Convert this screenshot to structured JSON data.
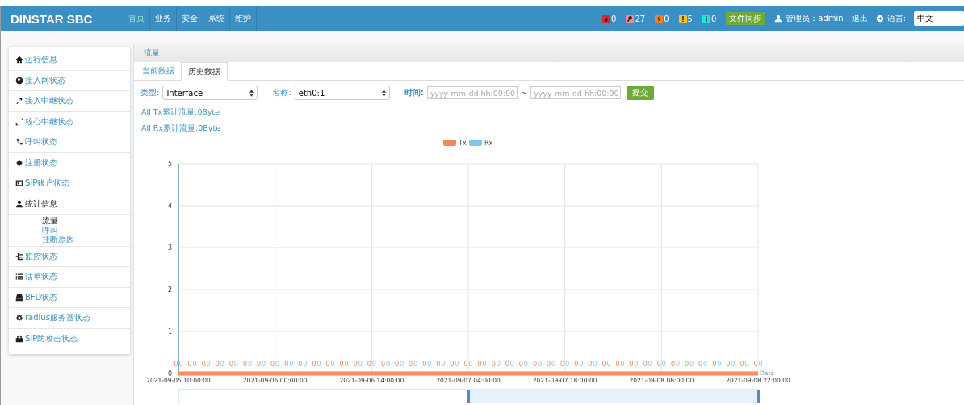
{
  "header": {
    "logo": "DINSTAR SBC",
    "nav": [
      {
        "label": "首页",
        "selected": true
      },
      {
        "label": "业务",
        "selected": false
      },
      {
        "label": "安全",
        "selected": false
      },
      {
        "label": "系统",
        "selected": false
      },
      {
        "label": "维护",
        "selected": false
      }
    ],
    "alerts": [
      {
        "kind": "fire",
        "color": "#e0262b",
        "count": "0"
      },
      {
        "kind": "key",
        "color": "#f08c8c",
        "count": "27"
      },
      {
        "kind": "bolt",
        "color": "#f0862a",
        "count": "0"
      },
      {
        "kind": "exclaim",
        "color": "#f2c037",
        "count": "5"
      },
      {
        "kind": "info",
        "color": "#19e6e6",
        "count": "0"
      }
    ],
    "sync_button": "文件同步",
    "user": "管理员：admin",
    "logout": "退出",
    "language_label": "语言:",
    "language": "中文"
  },
  "sidebar": {
    "items": [
      {
        "kind": "home",
        "label": "运行信息",
        "expanded": false
      },
      {
        "kind": "globe",
        "label": "接入网状态",
        "expanded": false
      },
      {
        "kind": "arrow",
        "label": "接入中继状态",
        "expanded": false
      },
      {
        "kind": "arrows",
        "label": "核心中继状态",
        "expanded": false
      },
      {
        "kind": "phone",
        "label": "呼叫状态",
        "expanded": false
      },
      {
        "kind": "gear",
        "label": "注册状态",
        "expanded": false
      },
      {
        "kind": "card",
        "label": "SIP账户状态",
        "expanded": false
      },
      {
        "kind": "user",
        "label": "统计信息",
        "expanded": true,
        "children": [
          {
            "label": "流量",
            "selected": true
          },
          {
            "label": "呼叫",
            "selected": false
          },
          {
            "label": "挂断原因",
            "selected": false
          }
        ]
      },
      {
        "kind": "tree",
        "label": "监控状态",
        "expanded": false
      },
      {
        "kind": "list",
        "label": "话单状态",
        "expanded": false
      },
      {
        "kind": "drive",
        "label": "BFD状态",
        "expanded": false
      },
      {
        "kind": "cog",
        "label": "radius服务器状态",
        "expanded": false
      },
      {
        "kind": "lock",
        "label": "SIP防攻击状态",
        "expanded": false
      }
    ]
  },
  "panel": {
    "title": "流量",
    "tabs": [
      {
        "label": "当前数据",
        "selected": false
      },
      {
        "label": "历史数据",
        "selected": true
      }
    ],
    "filters": {
      "type_label": "类型:",
      "type": "Interface",
      "name_label": "名称:",
      "name": "eth0:1",
      "time_label": "时间:",
      "start_placeholder": "yyyy-mm-dd hh:00:00",
      "separator": "~",
      "end_placeholder": "yyyy-mm-dd hh:00:00",
      "submit": "提交"
    },
    "totals": [
      "All Tx累计流量:0Byte",
      "All Rx累计流量:0Byte"
    ],
    "chart_data": {
      "type": "line",
      "xlabel": "Data",
      "grid": true,
      "legend": true,
      "ylim": [
        0,
        5
      ],
      "yticks": [
        0,
        1,
        2,
        3,
        4,
        5
      ],
      "data_labels": true,
      "categories": [
        "2021-09-05 10:00:00",
        null,
        null,
        null,
        null,
        null,
        null,
        "2021-09-06 00:00:00",
        null,
        null,
        null,
        null,
        null,
        null,
        "2021-09-06 14:00:00",
        null,
        null,
        null,
        null,
        null,
        null,
        "2021-09-07 04:00:00",
        null,
        null,
        null,
        null,
        null,
        null,
        "2021-09-07 18:00:00",
        null,
        null,
        null,
        null,
        null,
        null,
        "2021-09-08 08:00:00",
        null,
        null,
        null,
        null,
        null,
        null,
        "2021-09-08 22:00:00"
      ],
      "series": [
        {
          "name": "Tx",
          "color": "#f7845a",
          "values": [
            0,
            0,
            0,
            0,
            0,
            0,
            0,
            0,
            0,
            0,
            0,
            0,
            0,
            0,
            0,
            0,
            0,
            0,
            0,
            0,
            0,
            0,
            0,
            0,
            0,
            0,
            0,
            0,
            0,
            0,
            0,
            0,
            0,
            0,
            0,
            0,
            0,
            0,
            0,
            0,
            0,
            0,
            0
          ]
        },
        {
          "name": "Rx",
          "color": "#87c4ec",
          "values": [
            0,
            0,
            0,
            0,
            0,
            0,
            0,
            0,
            0,
            0,
            0,
            0,
            0,
            0,
            0,
            0,
            0,
            0,
            0,
            0,
            0,
            0,
            0,
            0,
            0,
            0,
            0,
            0,
            0,
            0,
            0,
            0,
            0,
            0,
            0,
            0,
            0,
            0,
            0,
            0,
            0,
            0,
            0
          ]
        }
      ]
    }
  }
}
